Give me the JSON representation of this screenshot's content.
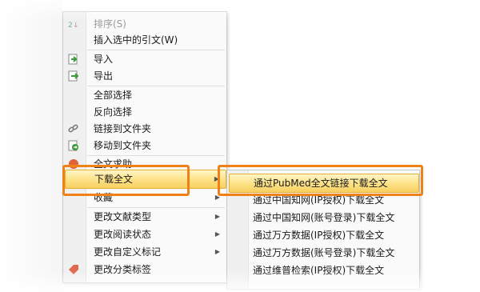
{
  "menu": {
    "items": [
      {
        "label": "排序(S)",
        "icon": "sort-icon",
        "disabled": true
      },
      {
        "label": "插入选中的引文(W)"
      },
      {
        "label": "导入",
        "icon": "import-icon"
      },
      {
        "label": "导出",
        "icon": "export-icon"
      },
      {
        "label": "全部选择"
      },
      {
        "label": "反向选择"
      },
      {
        "label": "链接到文件夹",
        "icon": "link-chain-icon"
      },
      {
        "label": "移动到文件夹",
        "icon": "move-to-folder-icon"
      },
      {
        "label": "全文求助",
        "icon": "fulltext-help-icon"
      },
      {
        "label": "下载全文",
        "icon": "",
        "has_submenu": true,
        "highlighted": true
      },
      {
        "label": "收藏",
        "has_submenu": true
      },
      {
        "label": "更改文献类型",
        "has_submenu": true
      },
      {
        "label": "更改阅读状态",
        "has_submenu": true
      },
      {
        "label": "更改自定义标记",
        "has_submenu": true
      },
      {
        "label": "更改分类标签",
        "icon": "tag-icon"
      }
    ]
  },
  "submenu": {
    "items": [
      {
        "label": "通过PubMed全文链接下载全文",
        "highlighted": true
      },
      {
        "label": "通过中国知网(IP授权)下载全文"
      },
      {
        "label": "通过中国知网(账号登录)下载全文"
      },
      {
        "label": "通过万方数据(IP授权)下载全文"
      },
      {
        "label": "通过万方数据(账号登录)下载全文"
      },
      {
        "label": "通过维普检索(IP授权)下载全文"
      }
    ]
  },
  "colors": {
    "highlight_border": "#f08018",
    "hover_fill": "#fde38a"
  }
}
